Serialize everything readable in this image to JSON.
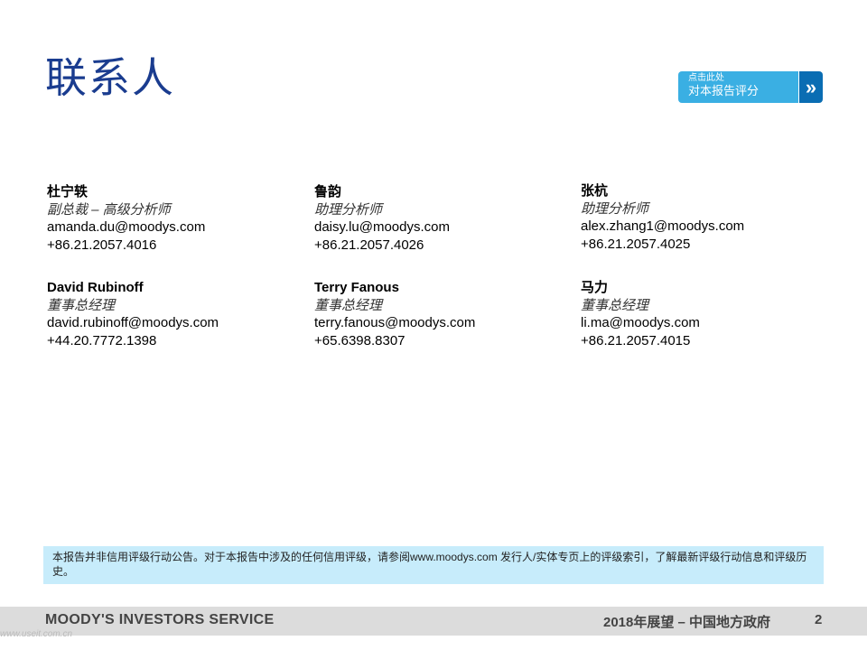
{
  "page_title": "联系人",
  "rate_button": {
    "line1": "点击此处",
    "line2": "对本报告评分",
    "icon": "double-chevron-right-icon",
    "arrow": "»"
  },
  "contacts": [
    {
      "name": "杜宁轶",
      "role": "副总裁 – 高级分析师",
      "email": "amanda.du@moodys.com",
      "phone": "+86.21.2057.4016"
    },
    {
      "name": "鲁韵",
      "role": "助理分析师",
      "email": "daisy.lu@moodys.com",
      "phone": "+86.21.2057.4026"
    },
    {
      "name": "张杭",
      "role": "助理分析师",
      "email": "alex.zhang1@moodys.com",
      "phone": "+86.21.2057.4025"
    },
    {
      "name": "David Rubinoff",
      "role": "董事总经理",
      "email": "david.rubinoff@moodys.com",
      "phone": "+44.20.7772.1398"
    },
    {
      "name": "Terry Fanous",
      "role": "董事总经理",
      "email": "terry.fanous@moodys.com",
      "phone": "+65.6398.8307"
    },
    {
      "name": "马力",
      "role": "董事总经理",
      "email": "li.ma@moodys.com",
      "phone": "+86.21.2057.4015"
    }
  ],
  "notice": "本报告并非信用评级行动公告。对于本报告中涉及的任何信用评级，请参阅www.moodys.com 发行人/实体专页上的评级索引，了解最新评级行动信息和评级历史。",
  "footer": {
    "brand": "MOODY'S INVESTORS SERVICE",
    "report_title": "2018年展望 – 中国地方政府",
    "page_number": "2",
    "watermark": "www.useit.com.cn"
  }
}
